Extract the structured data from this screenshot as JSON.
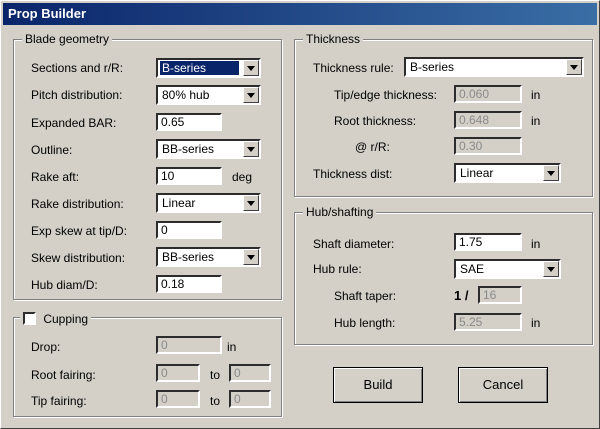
{
  "window": {
    "title": "Prop Builder"
  },
  "blade": {
    "legend": "Blade geometry",
    "sections_label": "Sections and r/R:",
    "sections_value": "B-series",
    "pitch_label": "Pitch distribution:",
    "pitch_value": "80% hub",
    "bar_label": "Expanded BAR:",
    "bar_value": "0.65",
    "outline_label": "Outline:",
    "outline_value": "BB-series",
    "rake_label": "Rake aft:",
    "rake_value": "10",
    "rake_unit": "deg",
    "rakedist_label": "Rake distribution:",
    "rakedist_value": "Linear",
    "expskew_label": "Exp skew at tip/D:",
    "expskew_value": "0",
    "skewdist_label": "Skew distribution:",
    "skewdist_value": "BB-series",
    "hubdiam_label": "Hub diam/D:",
    "hubdiam_value": "0.18"
  },
  "cupping": {
    "legend": "Cupping",
    "checked": false,
    "drop_label": "Drop:",
    "drop_value": "0",
    "drop_unit": "in",
    "root_label": "Root fairing:",
    "root_from": "0",
    "root_to_label": "to",
    "root_to": "0",
    "tip_label": "Tip fairing:",
    "tip_from": "0",
    "tip_to_label": "to",
    "tip_to": "0"
  },
  "thickness": {
    "legend": "Thickness",
    "rule_label": "Thickness rule:",
    "rule_value": "B-series",
    "tip_label": "Tip/edge thickness:",
    "tip_value": "0.060",
    "tip_unit": "in",
    "root_label": "Root thickness:",
    "root_value": "0.648",
    "root_unit": "in",
    "at_label": "@ r/R:",
    "at_value": "0.30",
    "dist_label": "Thickness dist:",
    "dist_value": "Linear"
  },
  "hub": {
    "legend": "Hub/shafting",
    "shaft_label": "Shaft diameter:",
    "shaft_value": "1.75",
    "shaft_unit": "in",
    "rule_label": "Hub rule:",
    "rule_value": "SAE",
    "taper_label": "Shaft taper:",
    "taper_prefix": "1 /",
    "taper_value": "16",
    "length_label": "Hub length:",
    "length_value": "5.25",
    "length_unit": "in"
  },
  "buttons": {
    "build": "Build",
    "cancel": "Cancel"
  }
}
